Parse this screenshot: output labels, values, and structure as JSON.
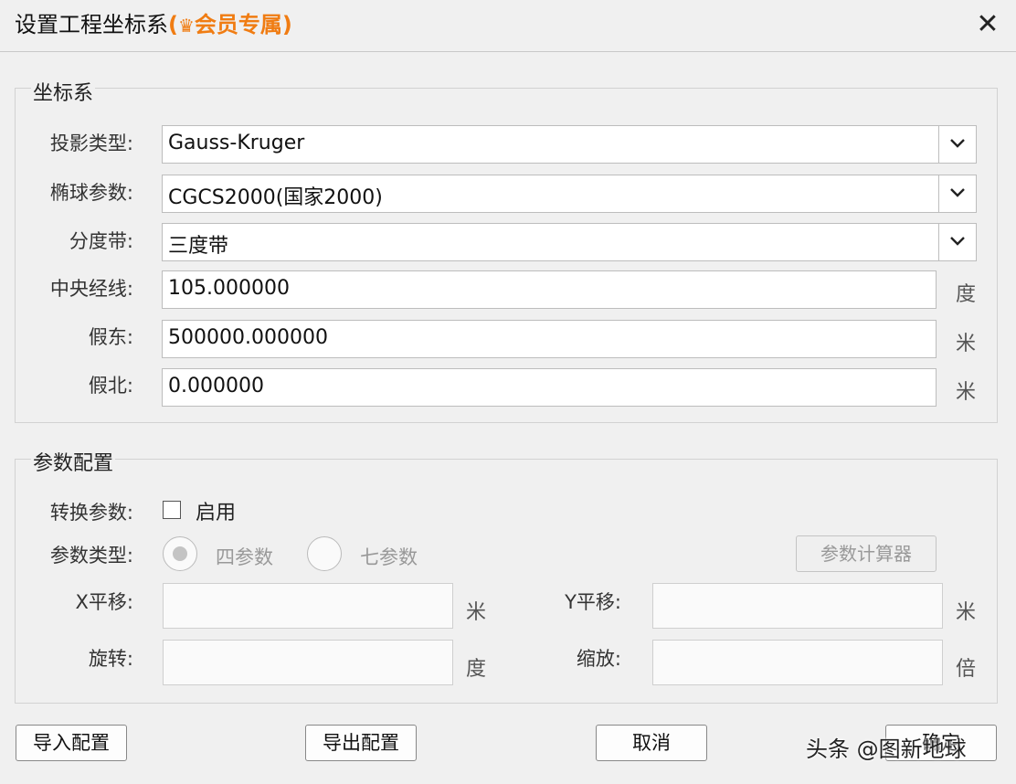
{
  "title": {
    "text": "设置工程坐标系",
    "open_paren": "(",
    "crown_icon": "♛",
    "vip": "会员专属",
    "close_paren": ")"
  },
  "close_glyph": "✕",
  "coord_group": {
    "title": "坐标系",
    "projection": {
      "label": "投影类型:",
      "value": "Gauss-Kruger"
    },
    "ellipsoid": {
      "label": "椭球参数:",
      "value": "CGCS2000(国家2000)"
    },
    "zone": {
      "label": "分度带:",
      "value": "三度带"
    },
    "central_meridian": {
      "label": "中央经线:",
      "value": "105.000000",
      "unit": "度"
    },
    "false_easting": {
      "label": "假东:",
      "value": "500000.000000",
      "unit": "米"
    },
    "false_northing": {
      "label": "假北:",
      "value": "0.000000",
      "unit": "米"
    }
  },
  "param_group": {
    "title": "参数配置",
    "transform": {
      "label": "转换参数:",
      "checkbox_label": "启用",
      "checked": false
    },
    "param_type": {
      "label": "参数类型:",
      "options": [
        {
          "label": "四参数",
          "selected": true
        },
        {
          "label": "七参数",
          "selected": false
        }
      ]
    },
    "calc_button": "参数计算器",
    "x_shift": {
      "label": "X平移:",
      "unit": "米",
      "value": ""
    },
    "y_shift": {
      "label": "Y平移:",
      "unit": "米",
      "value": ""
    },
    "rotation": {
      "label": "旋转:",
      "unit": "度",
      "value": ""
    },
    "scale": {
      "label": "缩放:",
      "unit": "倍",
      "value": ""
    }
  },
  "buttons": {
    "import": "导入配置",
    "export": "导出配置",
    "cancel": "取消",
    "ok": "确定"
  },
  "watermark": "头条 @图新地球"
}
